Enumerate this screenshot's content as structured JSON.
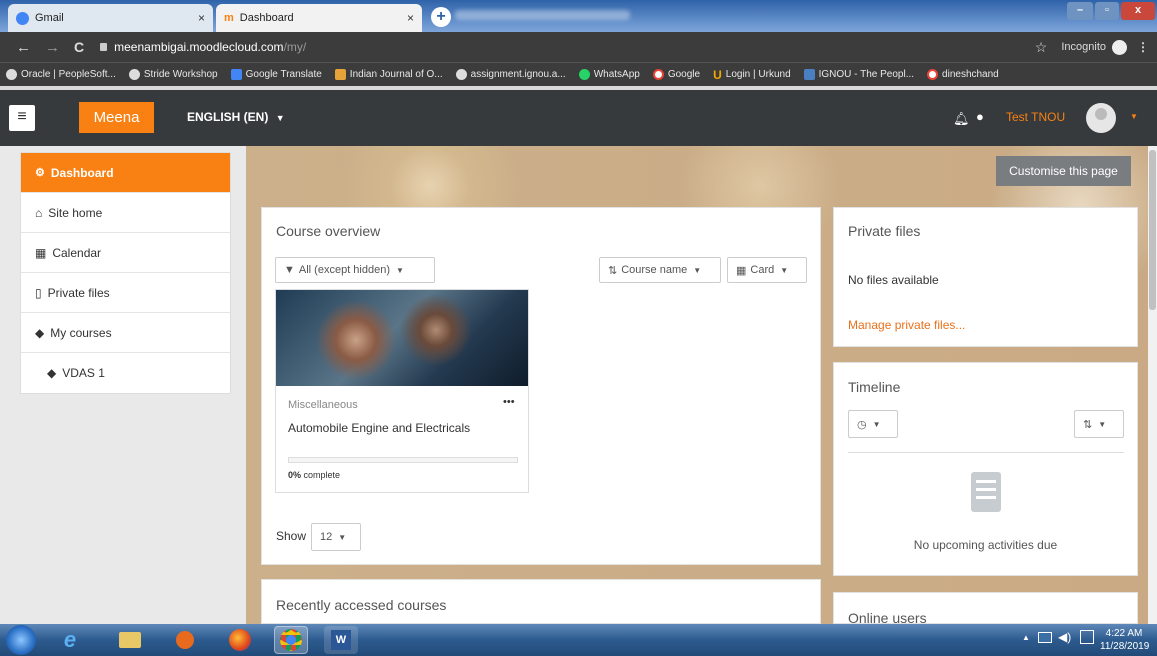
{
  "browser": {
    "tabs": [
      {
        "title": "Gmail",
        "close": "×"
      },
      {
        "title": "Dashboard",
        "close": "×"
      }
    ],
    "new_tab": "+",
    "blurred_tab": "",
    "window_controls": {
      "minimize": "–",
      "maximize": "▫",
      "close": "x"
    },
    "url": "meenambigai.moodlecloud.com",
    "url_path": "/my/",
    "incognito_label": "Incognito",
    "bookmarks": [
      {
        "label": "Oracle | PeopleSoft...",
        "color": "#5f6368"
      },
      {
        "label": "Stride Workshop",
        "color": "#5f6368"
      },
      {
        "label": "Google Translate",
        "color": "#4285f4"
      },
      {
        "label": "Indian Journal of O...",
        "color": "#e8a23a"
      },
      {
        "label": "assignment.ignou.a...",
        "color": "#5f6368"
      },
      {
        "label": "WhatsApp",
        "color": "#25d366"
      },
      {
        "label": "Google",
        "color": "#ea4335"
      },
      {
        "label": "Login | Urkund",
        "color": "#f6a800"
      },
      {
        "label": "IGNOU - The Peopl...",
        "color": "#4a7fc1"
      },
      {
        "label": "dineshchand",
        "color": "#ea4335"
      }
    ]
  },
  "navbar": {
    "site_name": "Meena",
    "language": "ENGLISH (EN)",
    "user_name": "Test TNOU",
    "accent": "#f98012"
  },
  "sidebar": {
    "items": [
      {
        "label": "Dashboard",
        "icon": "tachometer-icon",
        "active": true
      },
      {
        "label": "Site home",
        "icon": "home-icon",
        "active": false
      },
      {
        "label": "Calendar",
        "icon": "calendar-icon",
        "active": false
      },
      {
        "label": "Private files",
        "icon": "file-icon",
        "active": false
      },
      {
        "label": "My courses",
        "icon": "graduation-cap-icon",
        "active": false
      },
      {
        "label": "VDAS 1",
        "icon": "graduation-cap-icon",
        "active": false
      }
    ]
  },
  "main": {
    "customise_label": "Customise this page",
    "course_overview": {
      "title": "Course overview",
      "filter": "All (except hidden)",
      "sort": "Course name",
      "view": "Card",
      "course": {
        "category": "Miscellaneous",
        "name": "Automobile Engine and Electricals",
        "progress_pct": 0,
        "progress_suffix": " complete",
        "menu": "•••"
      },
      "show_label": "Show",
      "show_value": "12"
    },
    "recent_title": "Recently accessed courses"
  },
  "right": {
    "private_files": {
      "title": "Private files",
      "empty": "No files available",
      "manage": "Manage private files..."
    },
    "timeline": {
      "title": "Timeline",
      "empty": "No upcoming activities due"
    },
    "online_users": {
      "title": "Online users"
    }
  },
  "taskbar": {
    "time": "4:22 AM",
    "date": "11/28/2019",
    "tray_arrow": "▲"
  }
}
